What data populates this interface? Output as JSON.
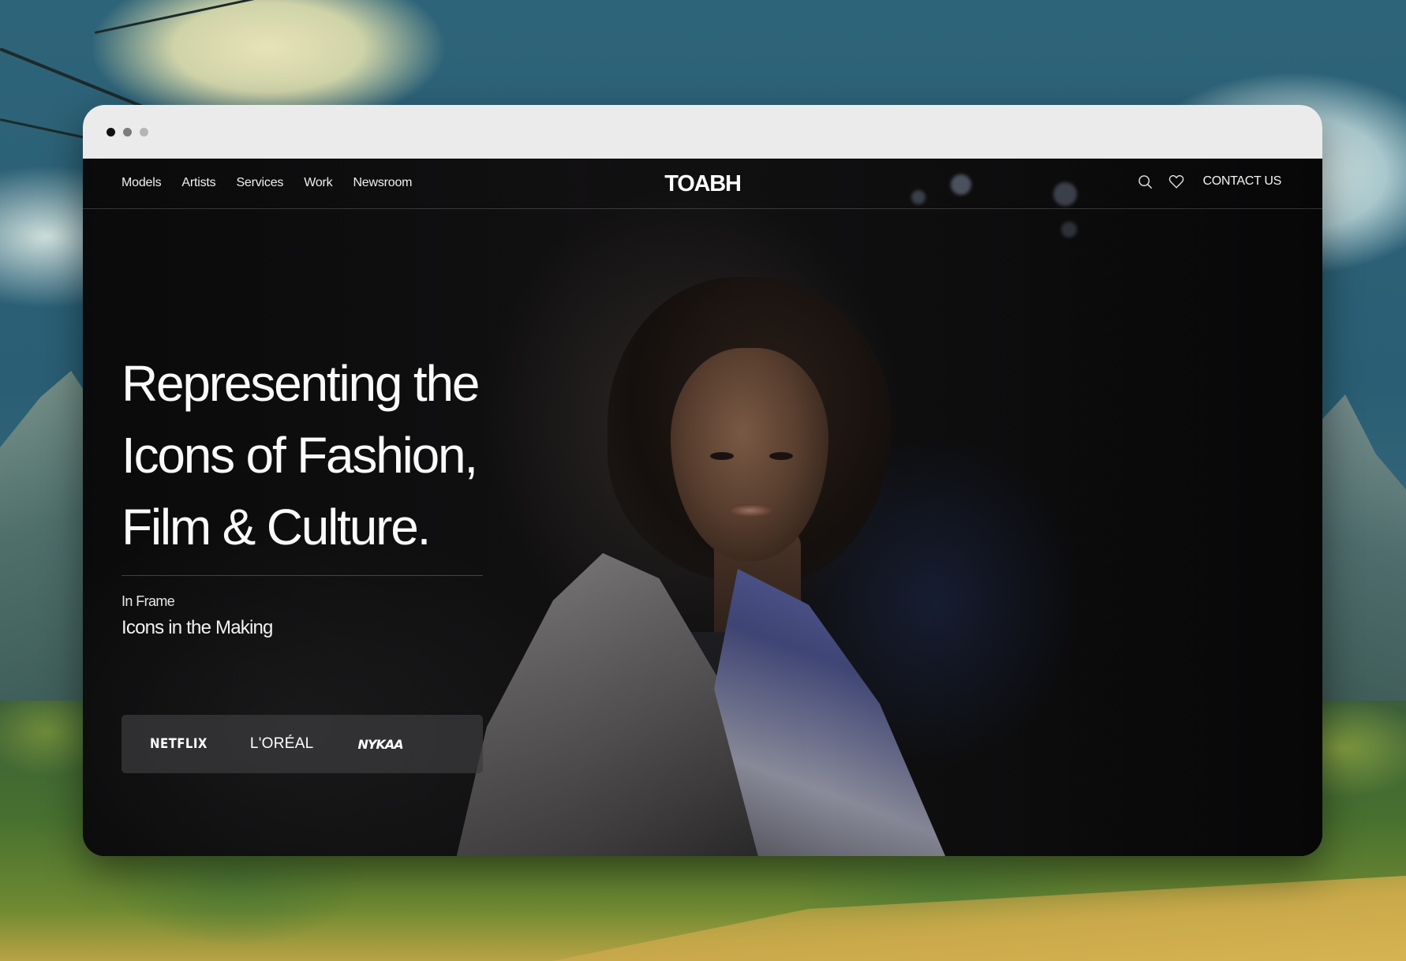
{
  "nav": {
    "links": [
      "Models",
      "Artists",
      "Services",
      "Work",
      "Newsroom"
    ],
    "logo": "TOABH",
    "search_icon": "search-icon",
    "wishlist_icon": "heart-icon",
    "contact_label": "CONTACT US"
  },
  "hero": {
    "headline_lines": [
      "Representing the",
      "Icons of Fashion,",
      "Film & Culture."
    ],
    "kicker": "In Frame",
    "subhead": "Icons in the Making",
    "brands": [
      "NETFLIX",
      "L'ORÉAL",
      "NYKAA"
    ]
  },
  "colors": {
    "page_bg": "#0b0b0c",
    "text": "#ffffff",
    "titlebar": "#ebebeb",
    "brand_strip": "#3c3c3e"
  }
}
